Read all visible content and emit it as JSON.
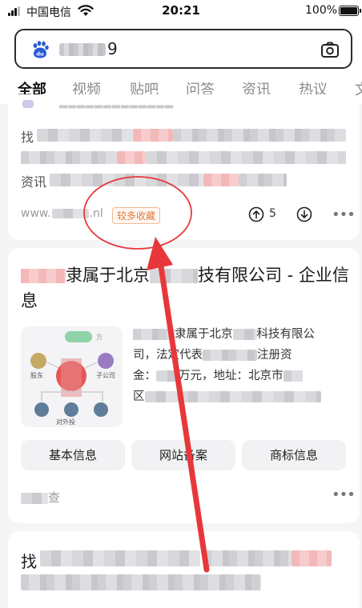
{
  "status_bar": {
    "carrier": "中国电信",
    "time": "20:21",
    "battery": "100%"
  },
  "search": {
    "query_visible": "9"
  },
  "tabs": [
    {
      "label": "全部",
      "active": true
    },
    {
      "label": "视频",
      "active": false
    },
    {
      "label": "贴吧",
      "active": false
    },
    {
      "label": "问答",
      "active": false
    },
    {
      "label": "资讯",
      "active": false
    },
    {
      "label": "热议",
      "active": false
    },
    {
      "label": "文",
      "active": false
    }
  ],
  "result1": {
    "line1_prefix": "找",
    "line3_prefix": "资讯",
    "url_prefix": "www.",
    "url_suffix": ".nl",
    "badge": "较多收藏",
    "upvotes": "5"
  },
  "result2": {
    "title_part1": "隶属于北京",
    "title_part2": "技有限公司 - 企业信息",
    "desc_1": "隶属于北京",
    "desc_2": "科技有限公",
    "desc_3": "司，法定代表",
    "desc_4": "注册资",
    "desc_5": "金：",
    "desc_6": "万元，地址：北京市",
    "desc_7": "区",
    "diagram": {
      "shareholder": "股东",
      "subsidiary": "子公司",
      "investment": "对外投"
    },
    "actions": [
      "基本信息",
      "网站备案",
      "商标信息"
    ],
    "source_suffix": "查"
  },
  "result3": {
    "first_char": "找"
  },
  "colors": {
    "accent_blue": "#2a5bd7",
    "badge_orange": "#e07a3f",
    "annotation_red": "#e8373b"
  },
  "icons": [
    "signal-icon",
    "wifi-icon",
    "battery-icon",
    "baidu-paw-icon",
    "camera-icon",
    "upvote-icon",
    "downvote-icon",
    "more-icon",
    "annotation-arrow",
    "annotation-circle"
  ]
}
